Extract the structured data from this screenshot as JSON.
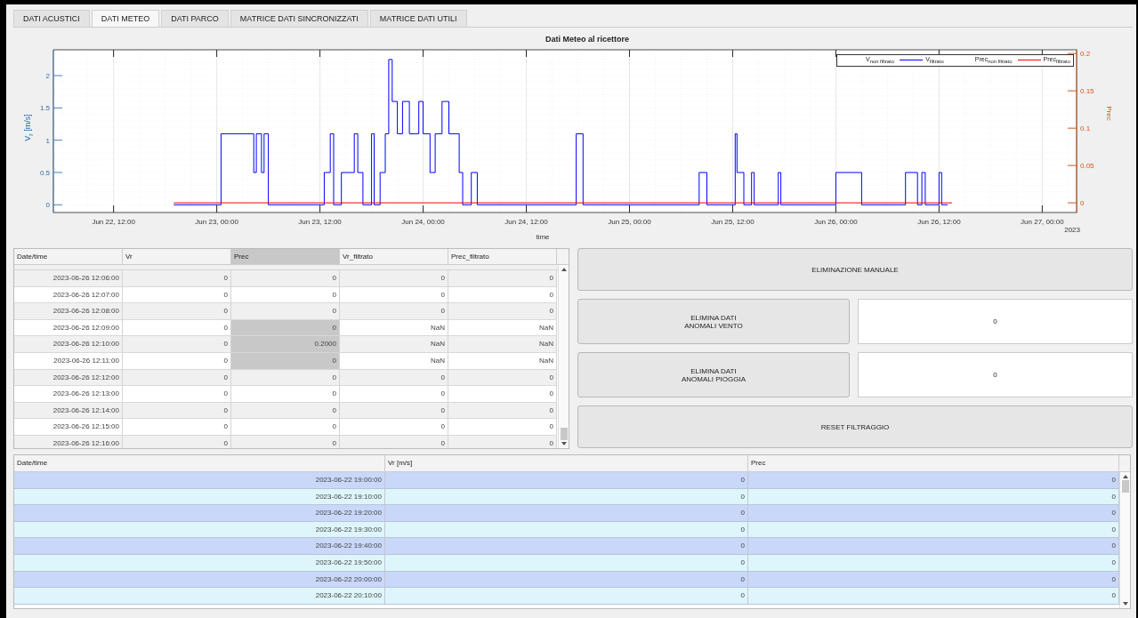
{
  "tabs": [
    {
      "label": "DATI ACUSTICI",
      "selected": false
    },
    {
      "label": "DATI METEO",
      "selected": true
    },
    {
      "label": "DATI PARCO",
      "selected": false
    },
    {
      "label": "MATRICE DATI SINCRONIZZATI",
      "selected": false
    },
    {
      "label": "MATRICE DATI UTILI",
      "selected": false
    }
  ],
  "chart": {
    "year_label": "2023",
    "legend": [
      {
        "label": "V$_{non filtrato}$"
      },
      {
        "label": "V$_{filtrato}$",
        "color": "#0000ff"
      },
      {
        "label": "Prec$_{non filtrato}$"
      },
      {
        "label": "Prec$_{filtrato}$",
        "color": "#ff0000"
      }
    ],
    "chart_data": {
      "type": "line",
      "title": "Dati Meteo al ricettore",
      "xlabel": "time",
      "ylabel": "V$_{r}$ [m/s]",
      "y2label": "Prec",
      "grid": true,
      "xlim": [
        "2023-06-22T05:00",
        "2023-06-27T04:00"
      ],
      "ylim": [
        -0.12,
        2.4
      ],
      "y2lim": [
        -0.013,
        0.205
      ],
      "xticks": [
        {
          "value": "2023-06-22T12:00",
          "label": "Jun 22, 12:00"
        },
        {
          "value": "2023-06-23T00:00",
          "label": "Jun 23, 00:00"
        },
        {
          "value": "2023-06-23T12:00",
          "label": "Jun 23, 12:00"
        },
        {
          "value": "2023-06-24T00:00",
          "label": "Jun 24, 00:00"
        },
        {
          "value": "2023-06-24T12:00",
          "label": "Jun 24, 12:00"
        },
        {
          "value": "2023-06-25T00:00",
          "label": "Jun 25, 00:00"
        },
        {
          "value": "2023-06-25T12:00",
          "label": "Jun 25, 12:00"
        },
        {
          "value": "2023-06-26T00:00",
          "label": "Jun 26, 00:00"
        },
        {
          "value": "2023-06-26T12:00",
          "label": "Jun 26, 12:00"
        },
        {
          "value": "2023-06-27T00:00",
          "label": "Jun 27, 00:00"
        }
      ],
      "yticks": [
        {
          "value": 0,
          "label": "0"
        },
        {
          "value": 0.5,
          "label": "0.5"
        },
        {
          "value": 1,
          "label": "1"
        },
        {
          "value": 1.5,
          "label": "1.5"
        },
        {
          "value": 2,
          "label": "2"
        }
      ],
      "y2ticks": [
        {
          "value": 0,
          "label": "0"
        },
        {
          "value": 0.05,
          "label": "0.05"
        },
        {
          "value": 0.1,
          "label": "0.1"
        },
        {
          "value": 0.15,
          "label": "0.15"
        },
        {
          "value": 0.2,
          "label": "0.2"
        }
      ],
      "series": [
        {
          "color": "#0000ff",
          "x": [
            "2023-06-22T19:00",
            "2023-06-23T00:30",
            "2023-06-23T00:30",
            "2023-06-23T04:18",
            "2023-06-23T04:18",
            "2023-06-23T04:36",
            "2023-06-23T04:36",
            "2023-06-23T05:12",
            "2023-06-23T05:12",
            "2023-06-23T05:30",
            "2023-06-23T05:30",
            "2023-06-23T06:00",
            "2023-06-23T06:00",
            "2023-06-23T12:30",
            "2023-06-23T12:30",
            "2023-06-23T13:12",
            "2023-06-23T13:12",
            "2023-06-23T13:36",
            "2023-06-23T13:36",
            "2023-06-23T14:30",
            "2023-06-23T14:30",
            "2023-06-23T16:00",
            "2023-06-23T16:00",
            "2023-06-23T16:24",
            "2023-06-23T16:24",
            "2023-06-23T17:00",
            "2023-06-23T17:00",
            "2023-06-23T18:00",
            "2023-06-23T18:00",
            "2023-06-23T18:18",
            "2023-06-23T18:18",
            "2023-06-23T19:00",
            "2023-06-23T19:00",
            "2023-06-23T19:36",
            "2023-06-23T19:36",
            "2023-06-23T20:00",
            "2023-06-23T20:00",
            "2023-06-23T20:24",
            "2023-06-23T20:24",
            "2023-06-23T21:00",
            "2023-06-23T21:00",
            "2023-06-23T21:36",
            "2023-06-23T21:36",
            "2023-06-23T22:24",
            "2023-06-23T22:24",
            "2023-06-23T23:30",
            "2023-06-23T23:30",
            "2023-06-24T00:00",
            "2023-06-24T00:00",
            "2023-06-24T00:48",
            "2023-06-24T00:48",
            "2023-06-24T01:24",
            "2023-06-24T01:24",
            "2023-06-24T02:12",
            "2023-06-24T02:12",
            "2023-06-24T03:00",
            "2023-06-24T03:00",
            "2023-06-24T04:12",
            "2023-06-24T04:12",
            "2023-06-24T04:36",
            "2023-06-24T04:36",
            "2023-06-24T05:36",
            "2023-06-24T05:36",
            "2023-06-24T06:18",
            "2023-06-24T06:18",
            "2023-06-24T17:48",
            "2023-06-24T17:48",
            "2023-06-24T18:36",
            "2023-06-24T18:36",
            "2023-06-25T08:06",
            "2023-06-25T08:06",
            "2023-06-25T09:00",
            "2023-06-25T09:00",
            "2023-06-25T12:18",
            "2023-06-25T12:18",
            "2023-06-25T12:30",
            "2023-06-25T12:30",
            "2023-06-25T13:18",
            "2023-06-25T13:18",
            "2023-06-25T14:12",
            "2023-06-25T14:12",
            "2023-06-25T14:30",
            "2023-06-25T14:30",
            "2023-06-25T17:18",
            "2023-06-25T17:18",
            "2023-06-25T17:36",
            "2023-06-25T17:36",
            "2023-06-26T00:00",
            "2023-06-26T00:00",
            "2023-06-26T03:00",
            "2023-06-26T03:00",
            "2023-06-26T08:06",
            "2023-06-26T08:06",
            "2023-06-26T09:30",
            "2023-06-26T09:30",
            "2023-06-26T10:00",
            "2023-06-26T10:00",
            "2023-06-26T10:24",
            "2023-06-26T10:24",
            "2023-06-26T12:00",
            "2023-06-26T12:00",
            "2023-06-26T12:18",
            "2023-06-26T12:18",
            "2023-06-26T13:00"
          ],
          "values": [
            0,
            0,
            1.1,
            1.1,
            0.5,
            0.5,
            1.1,
            1.1,
            0.5,
            0.5,
            1.1,
            1.1,
            0,
            0,
            0.5,
            0.5,
            1.1,
            1.1,
            0,
            0,
            0.5,
            0.5,
            1.1,
            1.1,
            0.5,
            0.5,
            0,
            0,
            1.1,
            1.1,
            0,
            0,
            0.5,
            0.5,
            1.1,
            1.1,
            2.25,
            2.25,
            1.6,
            1.6,
            1.1,
            1.1,
            1.6,
            1.6,
            1.1,
            1.1,
            1.6,
            1.6,
            1.1,
            1.1,
            0.5,
            0.5,
            1.1,
            1.1,
            1.6,
            1.6,
            1.1,
            1.1,
            0.5,
            0.5,
            0,
            0,
            0.5,
            0.5,
            0,
            0,
            1.1,
            1.1,
            0,
            0,
            0.5,
            0.5,
            0,
            0,
            1.1,
            1.1,
            0.5,
            0.5,
            0,
            0,
            0.5,
            0.5,
            0,
            0,
            0.5,
            0.5,
            0,
            0,
            0.5,
            0.5,
            0,
            0,
            0.5,
            0.5,
            0,
            0,
            0.5,
            0.5,
            0,
            0,
            0.5,
            0.5,
            0,
            0
          ]
        },
        {
          "color": "#ff0000",
          "axis": "y2",
          "x": [
            "2023-06-22T19:00",
            "2023-06-26T13:30"
          ],
          "values": [
            0,
            0
          ]
        }
      ]
    }
  },
  "detail_table": {
    "columns": [
      {
        "label": "Date/time",
        "selected": false
      },
      {
        "label": "Vr",
        "selected": false
      },
      {
        "label": "Prec",
        "selected": true
      },
      {
        "label": "Vr_filtrato",
        "selected": false
      },
      {
        "label": "Prec_filtrato",
        "selected": false
      }
    ],
    "rows": [
      {
        "cells": [
          "2023-06-26 12:06:00",
          "0",
          "0",
          "0",
          "0"
        ],
        "selected": false
      },
      {
        "cells": [
          "2023-06-26 12:07:00",
          "0",
          "0",
          "0",
          "0"
        ],
        "selected": false
      },
      {
        "cells": [
          "2023-06-26 12:08:00",
          "0",
          "0",
          "0",
          "0"
        ],
        "selected": false
      },
      {
        "cells": [
          "2023-06-26 12:09:00",
          "0",
          "0",
          "NaN",
          "NaN"
        ],
        "selected": true
      },
      {
        "cells": [
          "2023-06-26 12:10:00",
          "0",
          "0.2000",
          "NaN",
          "NaN"
        ],
        "selected": true
      },
      {
        "cells": [
          "2023-06-26 12:11:00",
          "0",
          "0",
          "NaN",
          "NaN"
        ],
        "selected": true
      },
      {
        "cells": [
          "2023-06-26 12:12:00",
          "0",
          "0",
          "0",
          "0"
        ],
        "selected": false
      },
      {
        "cells": [
          "2023-06-26 12:13:00",
          "0",
          "0",
          "0",
          "0"
        ],
        "selected": false
      },
      {
        "cells": [
          "2023-06-26 12:14:00",
          "0",
          "0",
          "0",
          "0"
        ],
        "selected": false
      },
      {
        "cells": [
          "2023-06-26 12:15:00",
          "0",
          "0",
          "0",
          "0"
        ],
        "selected": false
      },
      {
        "cells": [
          "2023-06-26 12:16:00",
          "0",
          "0",
          "0",
          "0"
        ],
        "selected": false
      }
    ]
  },
  "controls": {
    "manual_button": "ELIMINAZIONE MANUALE",
    "rows": [
      {
        "button": "ELIMINA DATI\nANOMALI VENTO",
        "value": "0"
      },
      {
        "button": "ELIMINA DATI\nANOMALI PIOGGIA",
        "value": "0"
      }
    ],
    "reset_button": "RESET FILTRAGGIO"
  },
  "data_table": {
    "columns": [
      "Date/time",
      "Vr [m/s]",
      "Prec"
    ],
    "rows": [
      [
        "2023-06-22 19:00:00",
        "0",
        "0"
      ],
      [
        "2023-06-22 19:10:00",
        "0",
        "0"
      ],
      [
        "2023-06-22 19:20:00",
        "0",
        "0"
      ],
      [
        "2023-06-22 19:30:00",
        "0",
        "0"
      ],
      [
        "2023-06-22 19:40:00",
        "0",
        "0"
      ],
      [
        "2023-06-22 19:50:00",
        "0",
        "0"
      ],
      [
        "2023-06-22 20:00:00",
        "0",
        "0"
      ],
      [
        "2023-06-22 20:10:00",
        "0",
        "0"
      ]
    ]
  }
}
